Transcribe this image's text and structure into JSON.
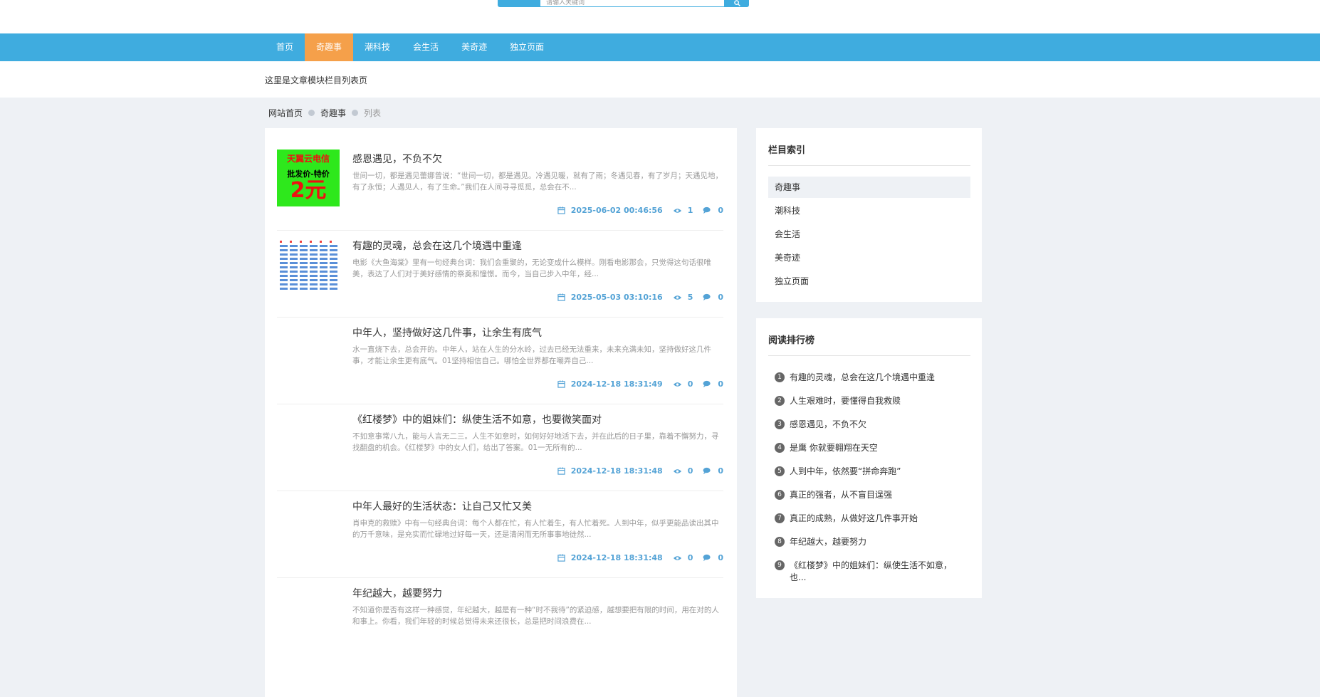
{
  "search": {
    "placeholder": "请输入关键词",
    "button_icon": "search-icon"
  },
  "nav": {
    "items": [
      {
        "label": "首页",
        "active": false
      },
      {
        "label": "奇趣事",
        "active": true
      },
      {
        "label": "潮科技",
        "active": false
      },
      {
        "label": "会生活",
        "active": false
      },
      {
        "label": "美奇迹",
        "active": false
      },
      {
        "label": "独立页面",
        "active": false
      }
    ]
  },
  "description": "这里是文章模块栏目列表页",
  "breadcrumb": {
    "home": "网站首页",
    "category": "奇趣事",
    "current": "列表"
  },
  "articles": [
    {
      "title": "感恩遇见，不负不欠",
      "summary": "世间一切，都是遇见蕾娜曾说：“世间一切，都是遇见。冷遇见暖，就有了雨；冬遇见春，有了岁月；天遇见地，有了永恒；人遇见人，有了生命。”我们在人间寻寻觅觅，总会在不...",
      "date": "2025-06-02 00:46:56",
      "views": "1",
      "comments": "0",
      "thumb": "ad"
    },
    {
      "title": "有趣的灵魂，总会在这几个境遇中重逢",
      "summary": "电影《大鱼海棠》里有一句经典台词：我们会重聚的，无论变成什么模样。刚看电影那会，只觉得这句话很唯美，表达了人们对于美好感情的祭奠和憧憬。而今，当自己步入中年，经...",
      "date": "2025-05-03 03:10:16",
      "views": "5",
      "comments": "0",
      "thumb": "grid"
    },
    {
      "title": "中年人，坚持做好这几件事，让余生有底气",
      "summary": "水一直烧下去，总会开的。中年人，站在人生的分水岭，过去已经无法重来，未来充满未知，坚持做好这几件事，才能让余生更有底气。01坚持相信自己。哪怕全世界都在嘲弄自己...",
      "date": "2024-12-18 18:31:49",
      "views": "0",
      "comments": "0",
      "thumb": "none"
    },
    {
      "title": "《红楼梦》中的姐妹们：纵使生活不如意，也要微笑面对",
      "summary": "不如意事常八九，能与人言无二三。人生不如意时，如何好好地活下去，并在此后的日子里，靠着不懈努力，寻找翻盘的机会。《红楼梦》中的女人们，给出了答案。01一无所有的...",
      "date": "2024-12-18 18:31:48",
      "views": "0",
      "comments": "0",
      "thumb": "none"
    },
    {
      "title": "中年人最好的生活状态：让自己又忙又美",
      "summary": "肖申克的救赎》中有一句经典台词：每个人都在忙，有人忙着生，有人忙着死。人到中年，似乎更能品读出其中的万千意味，是充实而忙碌地过好每一天，还是清闲而无所事事地徒然...",
      "date": "2024-12-18 18:31:48",
      "views": "0",
      "comments": "0",
      "thumb": "none"
    },
    {
      "title": "年纪越大，越要努力",
      "summary": "不知道你是否有这样一种感觉，年纪越大，越是有一种“时不我待”的紧迫感，越想要把有限的时间，用在对的人和事上。你看，我们年轻的时候总觉得未来还很长，总是把时间浪费在...",
      "date": "",
      "views": "",
      "comments": "",
      "thumb": "none"
    }
  ],
  "ad_thumb": {
    "line1": "天翼云电信",
    "line2": "批发价-特价",
    "line3": "2元"
  },
  "sidebar": {
    "category_title": "栏目索引",
    "categories": [
      {
        "label": "奇趣事",
        "active": true
      },
      {
        "label": "潮科技",
        "active": false
      },
      {
        "label": "会生活",
        "active": false
      },
      {
        "label": "美奇迹",
        "active": false
      },
      {
        "label": "独立页面",
        "active": false
      }
    ],
    "rank_title": "阅读排行榜",
    "ranks": [
      {
        "num": "1",
        "title": "有趣的灵魂，总会在这几个境遇中重逢"
      },
      {
        "num": "2",
        "title": "人生艰难时，要懂得自我救赎"
      },
      {
        "num": "3",
        "title": "感恩遇见，不负不欠"
      },
      {
        "num": "4",
        "title": "是鹰 你就要翱翔在天空"
      },
      {
        "num": "5",
        "title": "人到中年，依然要“拼命奔跑”"
      },
      {
        "num": "6",
        "title": "真正的强者，从不盲目逞强"
      },
      {
        "num": "7",
        "title": "真正的成熟，从做好这几件事开始"
      },
      {
        "num": "8",
        "title": "年纪越大，越要努力"
      },
      {
        "num": "9",
        "title": "《红楼梦》中的姐妹们：纵使生活不如意，也..."
      }
    ]
  },
  "colors": {
    "primary": "#3facdf",
    "accent": "#f5a04a",
    "meta": "#54a3d6",
    "background": "#eef1f5"
  }
}
